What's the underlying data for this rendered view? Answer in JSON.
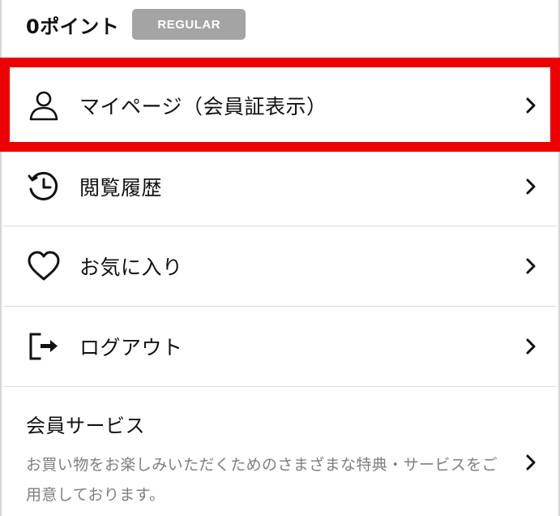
{
  "points": {
    "text": "0ポイント",
    "rank_badge": "REGULAR"
  },
  "menu": {
    "items": [
      {
        "label": "マイページ（会員証表示）",
        "icon": "user-icon"
      },
      {
        "label": "閲覧履歴",
        "icon": "history-icon"
      },
      {
        "label": "お気に入り",
        "icon": "heart-icon"
      },
      {
        "label": "ログアウト",
        "icon": "logout-icon"
      }
    ]
  },
  "service": {
    "title": "会員サービス",
    "description": "お買い物をお楽しみいただくためのさまざまな特典・サービスをご用意しております。"
  },
  "colors": {
    "highlight": "#ee0000",
    "badge_bg": "#a4a4a4",
    "text": "#111111",
    "muted_text": "#7f7f7f"
  }
}
